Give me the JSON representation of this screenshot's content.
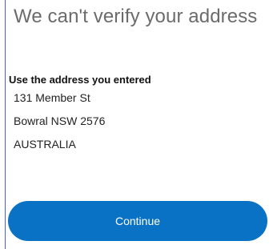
{
  "dialog": {
    "title": "We can't verify your address",
    "section_heading": "Use the address you entered",
    "address_lines": [
      "131 Member St",
      "Bowral NSW 2576",
      "AUSTRALIA"
    ],
    "continue_label": "Continue"
  },
  "colors": {
    "accent": "#0a72c4",
    "title_text": "#6b6b6b",
    "border": "#4a63b0"
  }
}
